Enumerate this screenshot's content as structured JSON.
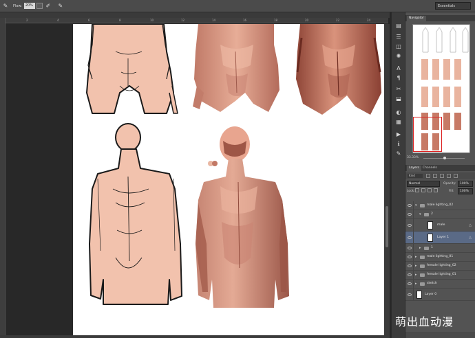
{
  "options_bar": {
    "tool_label": "Flow:",
    "flow_value": "20%",
    "workspace": "Essentials"
  },
  "navigator": {
    "tab_label": "Navigator",
    "zoom_value": "33.33%"
  },
  "layers_panel": {
    "tabs": [
      "Layers",
      "Channels"
    ],
    "filter_kind": "Kind",
    "blend_mode": "Normal",
    "opacity_label": "Opacity:",
    "opacity_value": "100%",
    "lock_label": "Lock:",
    "fill_label": "Fill:",
    "fill_value": "100%",
    "layers": [
      {
        "name": "male lighting_02",
        "type": "group",
        "expanded": true
      },
      {
        "name": "2",
        "type": "group",
        "expanded": true
      },
      {
        "name": "male",
        "type": "layer"
      },
      {
        "name": "Layer 1",
        "type": "layer",
        "selected": true
      },
      {
        "name": "1",
        "type": "group"
      },
      {
        "name": "male lighting_01",
        "type": "group"
      },
      {
        "name": "female lighting_02",
        "type": "group"
      },
      {
        "name": "female lighting_01",
        "type": "group"
      },
      {
        "name": "sketch",
        "type": "group"
      },
      {
        "name": "Layer 0",
        "type": "layer"
      }
    ]
  },
  "ruler_ticks": [
    "2",
    "4",
    "6",
    "8",
    "10",
    "12",
    "14",
    "16",
    "18",
    "20",
    "22",
    "24"
  ],
  "watermark": "萌出血动漫",
  "colors": {
    "skin_light": "#f2c2ad",
    "skin_shaded": "#d99a86",
    "skin_dark": "#a8584a",
    "line": "#1a1a1a",
    "panel_bg": "#535353",
    "selected_layer": "#5a6a86"
  }
}
